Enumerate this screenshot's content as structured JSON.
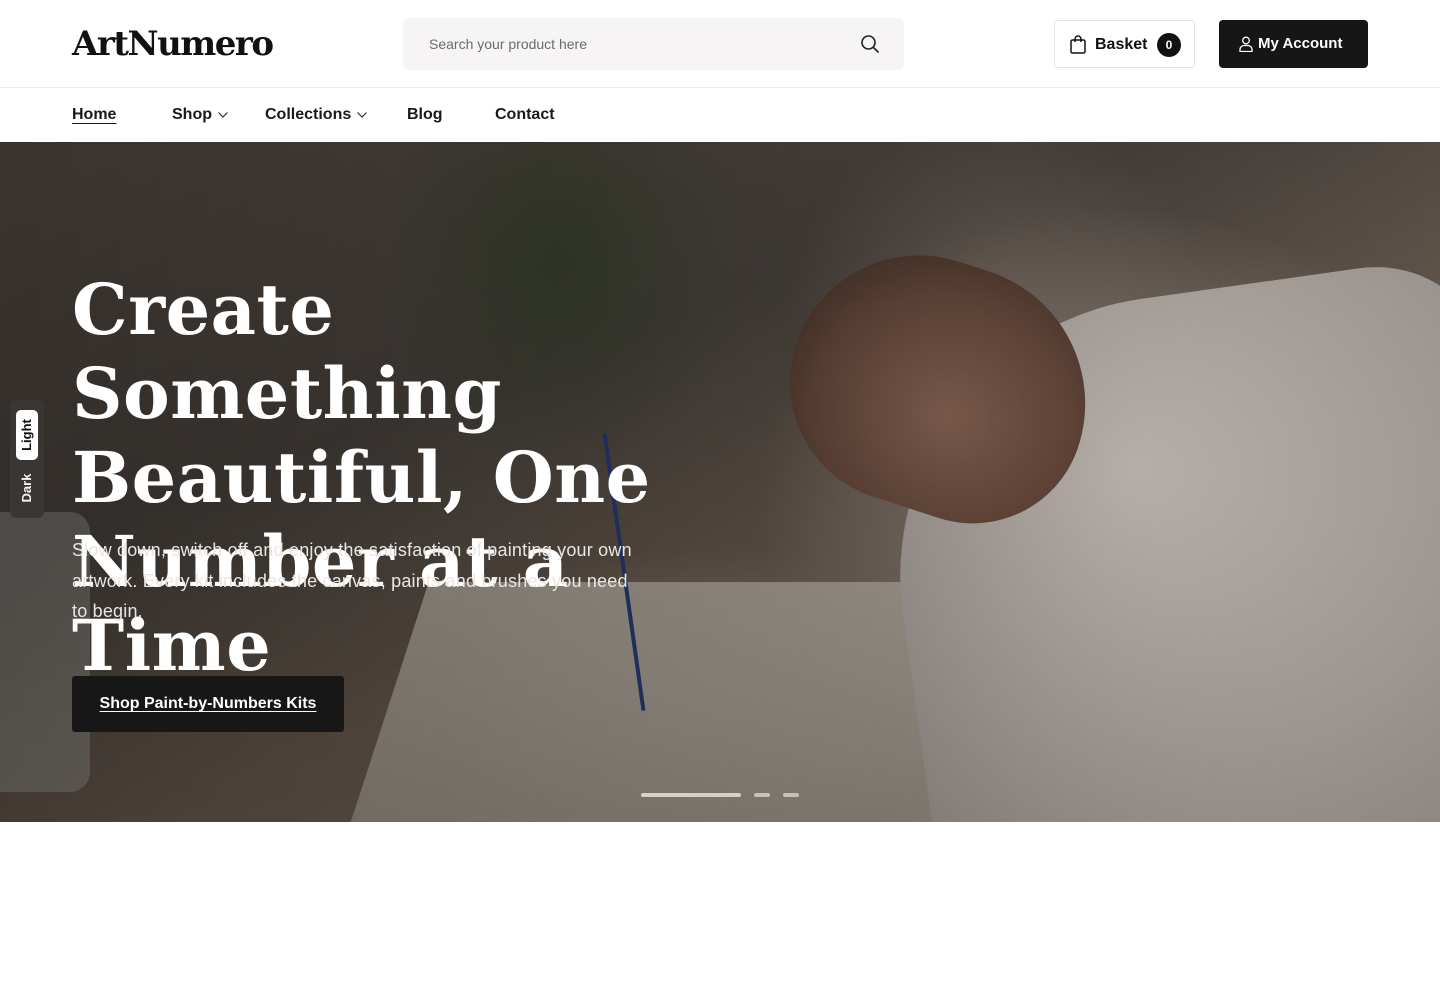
{
  "header": {
    "logo": "ArtNumero",
    "search": {
      "placeholder": "Search your product here",
      "icon": "search-icon"
    },
    "basket": {
      "label": "Basket",
      "count": "0",
      "icon": "shopping-bag-icon"
    },
    "account": {
      "label": "My Account",
      "icon": "user-icon"
    }
  },
  "nav": {
    "items": [
      {
        "label": "Home",
        "active": true,
        "dropdown": false
      },
      {
        "label": "Shop",
        "active": false,
        "dropdown": true
      },
      {
        "label": "Collections",
        "active": false,
        "dropdown": true
      },
      {
        "label": "Blog",
        "active": false,
        "dropdown": false
      },
      {
        "label": "Contact",
        "active": false,
        "dropdown": false
      }
    ]
  },
  "hero": {
    "title_lines": [
      "Create Something",
      "Beautiful, One",
      "Number at a Time"
    ],
    "subtitle": "Slow down, switch off and enjoy the satisfaction of painting your own artwork. Every kit includes the canvas, paints and brushes you need to begin.",
    "cta": "Shop Paint-by-Numbers Kits",
    "slides": {
      "count": 3,
      "active_index": 0
    }
  },
  "theme_toggle": {
    "light": "Light",
    "dark": "Dark",
    "selected": "Light"
  },
  "colors": {
    "primary_button": "#161616",
    "text": "#111111",
    "search_bg": "#f6f4f4"
  }
}
